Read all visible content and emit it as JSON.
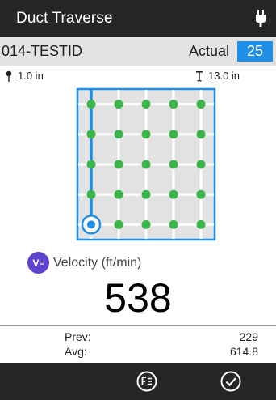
{
  "app": {
    "title": "Duct Traverse",
    "power_icon": "plug-icon"
  },
  "test": {
    "id": "014-TESTID",
    "actual_label": "Actual",
    "actual_count": "25"
  },
  "depth": {
    "start": "1.0 in",
    "end": "13.0 in"
  },
  "grid": {
    "rows": 5,
    "cols": 5,
    "current_point": {
      "row": 5,
      "col": 1
    }
  },
  "measurement": {
    "icon_text": "V",
    "label": "Velocity (ft/min)",
    "value": "538"
  },
  "stats": {
    "prev_label": "Prev:",
    "prev_value": "229",
    "avg_label": "Avg:",
    "avg_value": "614.8"
  },
  "actions": {
    "function_icon": "function-menu-icon",
    "accept_icon": "checkmark-icon"
  },
  "colors": {
    "accent": "#1e8ee6",
    "point": "#3ab54a",
    "icon_bg": "#5c42cc"
  }
}
